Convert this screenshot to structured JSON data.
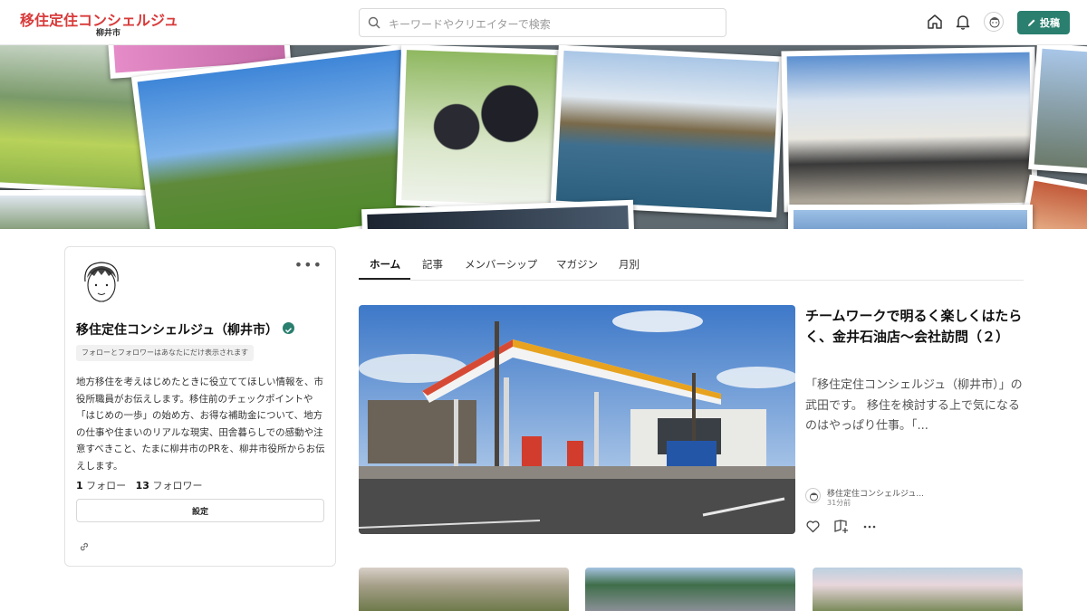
{
  "header": {
    "logo_text": "移住定住コンシェルジュ",
    "logo_sub": "柳井市",
    "search_placeholder": "キーワードやクリエイターで検索",
    "post_label": "投稿",
    "icons": [
      "home-icon",
      "bell-icon",
      "user-avatar",
      "pencil-icon"
    ]
  },
  "profile": {
    "name": "移住定住コンシェルジュ（柳井市）",
    "follow_note": "フォローとフォロワーはあなたにだけ表示されます",
    "description": "地方移住を考えはじめたときに役立ててほしい情報を、市役所職員がお伝えします。移住前のチェックポイントや「はじめの一歩」の始め方、お得な補助金について、地方の仕事や住まいのリアルな現実、田舎暮らしでの感動や注意すべきこと、たまに柳井市のPRを、柳井市役所からお伝えします。",
    "following_count": "1",
    "following_label": "フォロー",
    "followers_count": "13",
    "followers_label": "フォロワー",
    "settings_label": "設定",
    "more_label": "•••"
  },
  "tabs": [
    {
      "label": "ホーム",
      "active": true
    },
    {
      "label": "記事",
      "active": false
    },
    {
      "label": "メンバーシップ",
      "active": false
    },
    {
      "label": "マガジン",
      "active": false
    },
    {
      "label": "月別",
      "active": false
    }
  ],
  "featured": {
    "title": "チームワークで明るく楽しくはたらく、金井石油店～会社訪問（２）",
    "excerpt": "「移住定住コンシェルジュ（柳井市）」の武田です。 移住を検討する上で気になるのはやっぱり仕事。「...",
    "author": "移住定住コンシェルジュ...",
    "time": "31分前"
  },
  "colors": {
    "accent": "#2a7f6f",
    "border": "#e2e2e2"
  }
}
